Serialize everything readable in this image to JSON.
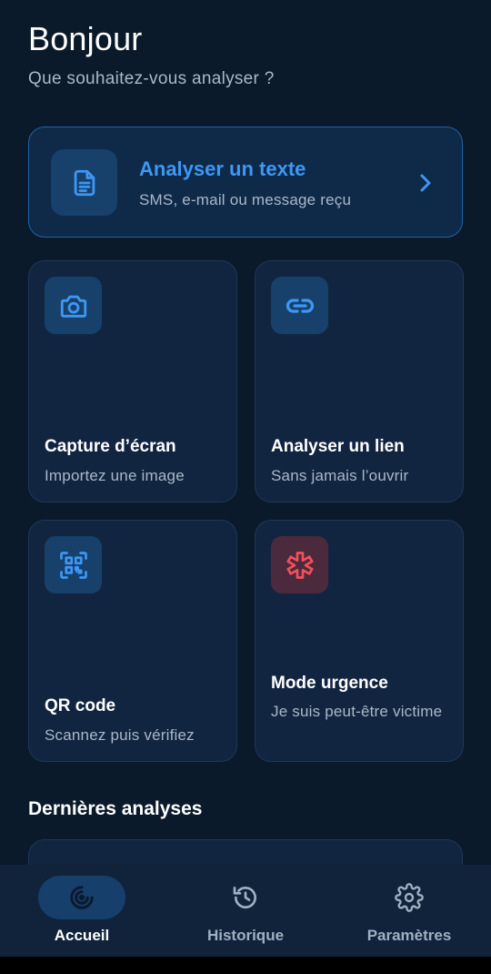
{
  "header": {
    "greeting": "Bonjour",
    "subtitle": "Que souhaitez-vous analyser ?"
  },
  "hero": {
    "title": "Analyser un texte",
    "description": "SMS, e-mail ou message reçu",
    "icon": "document-icon"
  },
  "cards": [
    {
      "title": "Capture d’écran",
      "description": "Importez une image",
      "icon": "camera-icon"
    },
    {
      "title": "Analyser un lien",
      "description": "Sans jamais l’ouvrir",
      "icon": "link-icon"
    },
    {
      "title": "QR code",
      "description": "Scannez puis vérifiez",
      "icon": "qr-code-icon"
    },
    {
      "title": "Mode urgence",
      "description": "Je suis peut-être victime",
      "icon": "emergency-icon"
    }
  ],
  "recent": {
    "title": "Dernières analyses"
  },
  "nav": {
    "items": [
      {
        "label": "Accueil",
        "icon": "home-target-icon",
        "active": true
      },
      {
        "label": "Historique",
        "icon": "history-icon",
        "active": false
      },
      {
        "label": "Paramètres",
        "icon": "gear-icon",
        "active": false
      }
    ]
  },
  "colors": {
    "background": "#0b1a2b",
    "accent": "#3d97f5",
    "card": "#122540",
    "danger": "#f0505a"
  }
}
